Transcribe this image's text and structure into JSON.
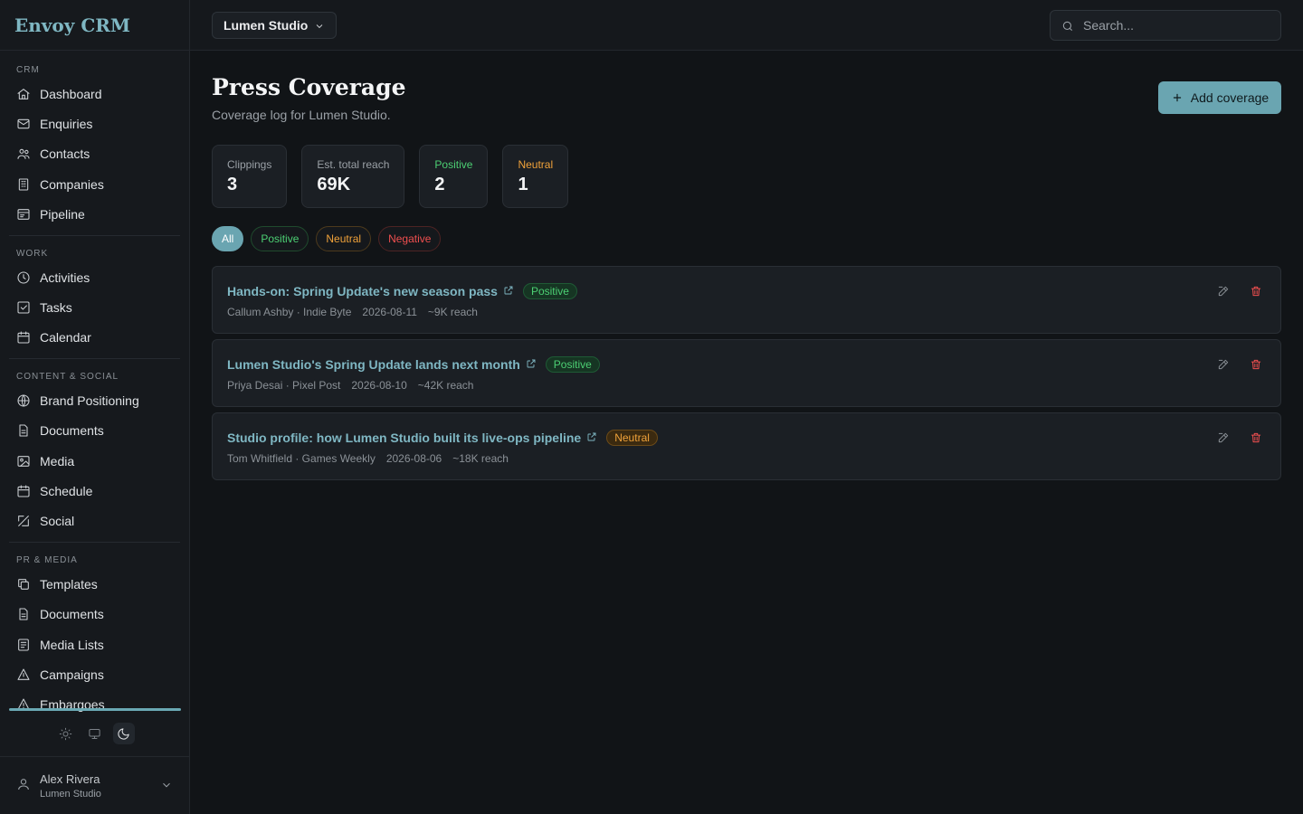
{
  "brand": "Envoy CRM",
  "workspace": "Lumen Studio",
  "search": {
    "placeholder": "Search..."
  },
  "sidebar": {
    "sections": [
      {
        "title": "CRM",
        "items": [
          {
            "label": "Dashboard",
            "icon": "home-icon"
          },
          {
            "label": "Enquiries",
            "icon": "mail-icon"
          },
          {
            "label": "Contacts",
            "icon": "users-icon"
          },
          {
            "label": "Companies",
            "icon": "building-icon"
          },
          {
            "label": "Pipeline",
            "icon": "pipeline-icon"
          }
        ]
      },
      {
        "title": "WORK",
        "items": [
          {
            "label": "Activities",
            "icon": "clock-icon"
          },
          {
            "label": "Tasks",
            "icon": "checkbox-icon"
          },
          {
            "label": "Calendar",
            "icon": "calendar-icon"
          }
        ]
      },
      {
        "title": "CONTENT & SOCIAL",
        "items": [
          {
            "label": "Brand Positioning",
            "icon": "globe-icon"
          },
          {
            "label": "Documents",
            "icon": "document-icon"
          },
          {
            "label": "Media",
            "icon": "image-icon"
          },
          {
            "label": "Schedule",
            "icon": "calendar-icon"
          },
          {
            "label": "Social",
            "icon": "send-icon"
          }
        ]
      },
      {
        "title": "PR & MEDIA",
        "items": [
          {
            "label": "Templates",
            "icon": "copy-icon"
          },
          {
            "label": "Documents",
            "icon": "document-icon"
          },
          {
            "label": "Media Lists",
            "icon": "list-icon"
          },
          {
            "label": "Campaigns",
            "icon": "triangle-icon"
          },
          {
            "label": "Embargoes",
            "icon": "alert-icon"
          }
        ]
      }
    ]
  },
  "user": {
    "name": "Alex Rivera",
    "org": "Lumen Studio"
  },
  "page": {
    "title": "Press Coverage",
    "subtitle": "Coverage log for Lumen Studio.",
    "add_button": "Add coverage"
  },
  "stats": [
    {
      "label": "Clippings",
      "value": "3",
      "color": "#9aa0a6"
    },
    {
      "label": "Est. total reach",
      "value": "69K",
      "color": "#9aa0a6"
    },
    {
      "label": "Positive",
      "value": "2",
      "color": "#4ccf73"
    },
    {
      "label": "Neutral",
      "value": "1",
      "color": "#f0a23a"
    }
  ],
  "filters": [
    "All",
    "Positive",
    "Neutral",
    "Negative"
  ],
  "coverage": [
    {
      "title": "Hands-on: Spring Update's new season pass",
      "sentiment": "Positive",
      "author": "Callum Ashby · Indie Byte",
      "date": "2026-08-11",
      "reach": "~9K reach"
    },
    {
      "title": "Lumen Studio's Spring Update lands next month",
      "sentiment": "Positive",
      "author": "Priya Desai · Pixel Post",
      "date": "2026-08-10",
      "reach": "~42K reach"
    },
    {
      "title": "Studio profile: how Lumen Studio built its live-ops pipeline",
      "sentiment": "Neutral",
      "author": "Tom Whitfield · Games Weekly",
      "date": "2026-08-06",
      "reach": "~18K reach"
    }
  ],
  "colors": {
    "accent": "#6aa5b1",
    "positive": "#4ccf73",
    "neutral": "#f0a23a",
    "negative": "#ef4f4f"
  }
}
